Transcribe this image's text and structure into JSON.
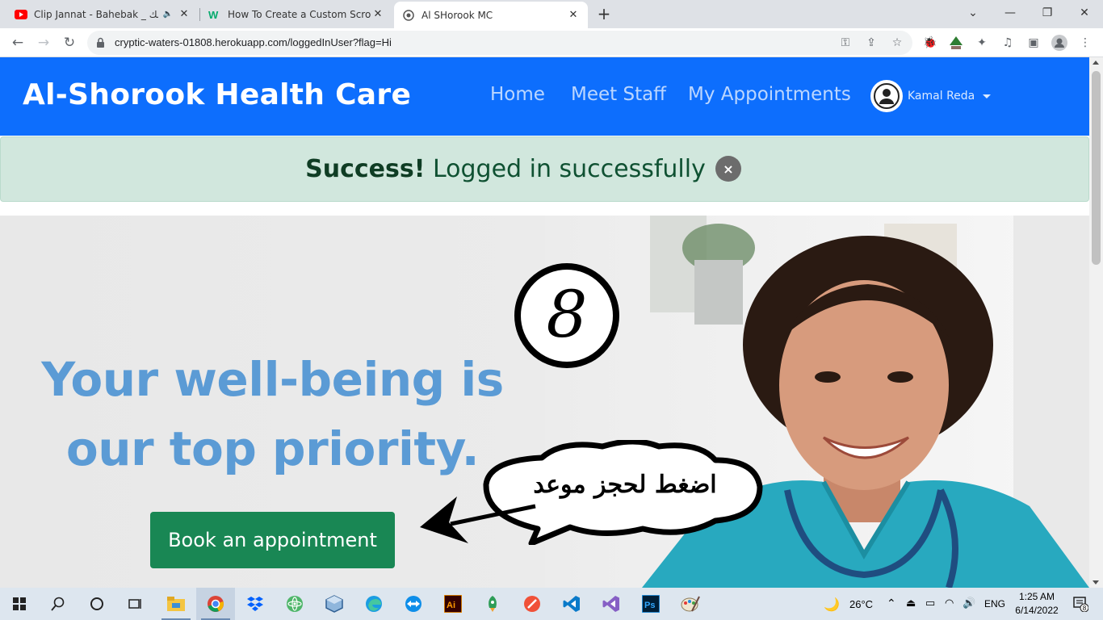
{
  "browser": {
    "tabs": [
      {
        "title": "Clip Jannat - Bahebak _ بحبك",
        "favicon": "youtube-icon",
        "audio": true
      },
      {
        "title": "How To Create a Custom Scrollbar",
        "favicon": "w3schools-icon",
        "audio": false
      },
      {
        "title": "Al SHorook MC",
        "favicon": "site-icon",
        "audio": false
      }
    ],
    "url": "cryptic-waters-01808.herokuapp.com/loggedInUser?flag=Hi"
  },
  "navbar": {
    "brand": "Al-Shorook Health Care",
    "links": [
      "Home",
      "Meet Staff",
      "My Appointments"
    ],
    "user_name": "Kamal Reda",
    "color": "#0d6efd"
  },
  "alert": {
    "strong": "Success!",
    "message": "Logged in successfully",
    "close": "×"
  },
  "hero": {
    "headline_line1": "Your well-being is",
    "headline_line2": "our top priority.",
    "button_label": "Book an appointment",
    "logo_text": "8",
    "annotation_arabic": "اضغط لحجز موعد",
    "button_color": "#198754",
    "headline_color": "#5b9bd5"
  },
  "taskbar": {
    "weather": "26°C",
    "lang": "ENG",
    "time": "1:25 AM",
    "date": "6/14/2022",
    "notifications": "8"
  }
}
